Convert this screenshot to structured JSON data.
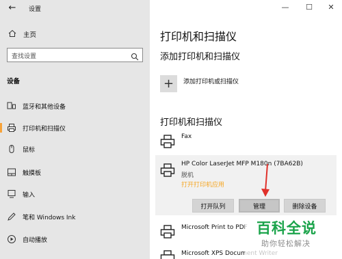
{
  "window": {
    "title": "设置",
    "back_icon": "back-arrow-icon",
    "controls": {
      "minimize": "—",
      "maximize": "☐",
      "close": "✕"
    }
  },
  "sidebar": {
    "home_label": "主页",
    "search_placeholder": "查找设置",
    "section_title": "设备",
    "items": [
      {
        "label": "蓝牙和其他设备",
        "icon": "bluetooth-devices-icon",
        "selected": false
      },
      {
        "label": "打印机和扫描仪",
        "icon": "printer-icon",
        "selected": true
      },
      {
        "label": "鼠标",
        "icon": "mouse-icon",
        "selected": false
      },
      {
        "label": "触摸板",
        "icon": "touchpad-icon",
        "selected": false
      },
      {
        "label": "输入",
        "icon": "keyboard-icon",
        "selected": false
      },
      {
        "label": "笔和 Windows Ink",
        "icon": "pen-icon",
        "selected": false
      },
      {
        "label": "自动播放",
        "icon": "autoplay-icon",
        "selected": false
      }
    ]
  },
  "main": {
    "page_title": "打印机和扫描仪",
    "add_section_title": "添加打印机和扫描仪",
    "add_label": "添加打印机或扫描仪",
    "list_section_title": "打印机和扫描仪",
    "printers": [
      {
        "name": "Fax"
      },
      {
        "name": "HP Color LaserJet MFP M180n (7BA62B)",
        "status": "脱机",
        "link": "打开打印机应用"
      },
      {
        "name": "Microsoft Print to PDF"
      },
      {
        "name": "Microsoft XPS Document Writer"
      }
    ],
    "buttons": {
      "open_queue": "打开队列",
      "manage": "管理",
      "remove": "删除设备"
    }
  },
  "watermark": {
    "title": "百科全说",
    "subtitle": "助你轻松解决"
  },
  "colors": {
    "accent_selected": "#f7a33a",
    "link": "#f5a623",
    "arrow": "#e0302a",
    "watermark_green": "#1aa34a"
  }
}
